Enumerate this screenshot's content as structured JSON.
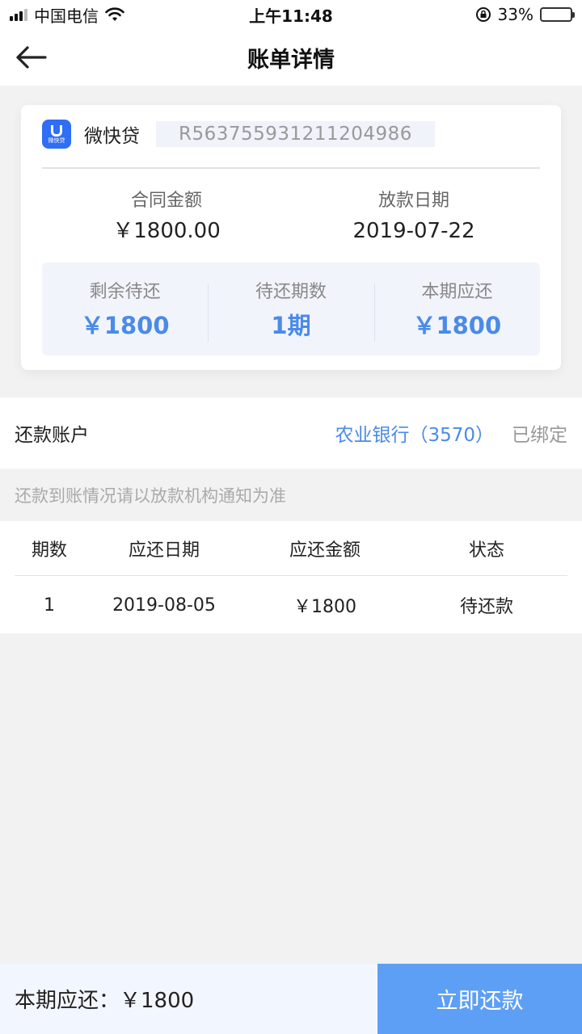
{
  "status_bar": {
    "carrier": "中国电信",
    "time": "上午11:48",
    "battery": "33%",
    "battery_level": 0.33
  },
  "nav": {
    "title": "账单详情",
    "back_icon": "arrow-left-icon"
  },
  "summary": {
    "lender_name": "微快贷",
    "logo_text": "微快贷",
    "loan_number": "R563755931211204986",
    "contract_amount_label": "合同金额",
    "contract_amount": "￥1800.00",
    "disbursement_date_label": "放款日期",
    "disbursement_date": "2019-07-22",
    "stats": [
      {
        "label": "剩余待还",
        "value": "￥1800"
      },
      {
        "label": "待还期数",
        "value": "1期"
      },
      {
        "label": "本期应还",
        "value": "￥1800"
      }
    ]
  },
  "account": {
    "label": "还款账户",
    "bank": "农业银行（3570）",
    "status": "已绑定"
  },
  "notice": "还款到账情况请以放款机构通知为准",
  "schedule": {
    "headers": [
      "期数",
      "应还日期",
      "应还金额",
      "状态"
    ],
    "rows": [
      [
        "1",
        "2019-08-05",
        "￥1800",
        "待还款"
      ]
    ]
  },
  "bottom_bar": {
    "amount_text": "本期应还：￥1800",
    "pay_button": "立即还款"
  },
  "colors": {
    "accent": "#4a8be8",
    "button": "#5e9ff6",
    "logo": "#2f6ef5"
  }
}
